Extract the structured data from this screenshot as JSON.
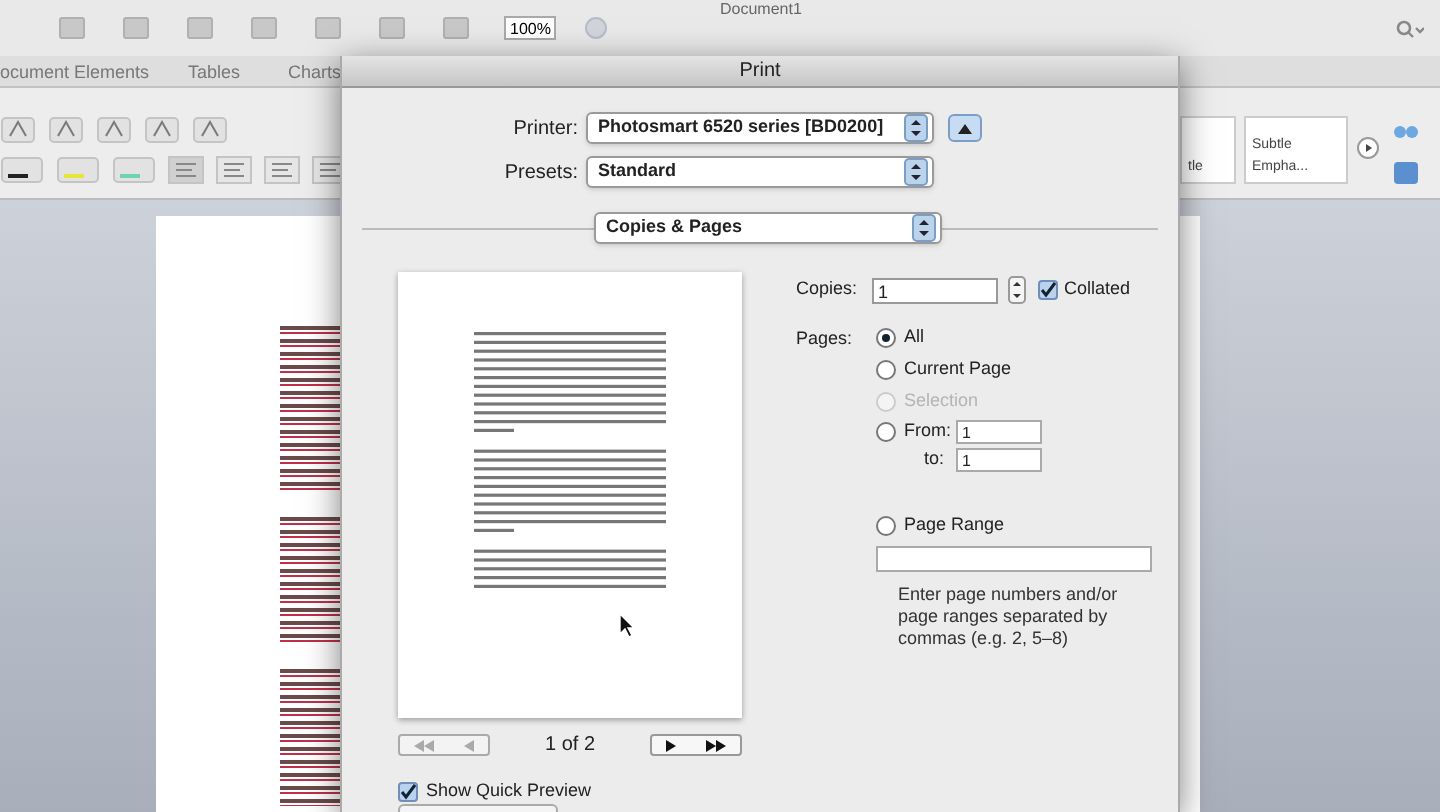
{
  "window": {
    "title": "Document1"
  },
  "toolbar": {
    "zoom": "100%"
  },
  "ribbon": {
    "tabs": [
      {
        "label": "ocument Elements"
      },
      {
        "label": "Tables"
      },
      {
        "label": "Charts"
      }
    ],
    "styles": [
      {
        "label": "tle"
      },
      {
        "label": "Subtle Empha..."
      }
    ]
  },
  "dialog": {
    "title": "Print",
    "printer": {
      "label": "Printer:",
      "value": "Photosmart 6520 series [BD0200]"
    },
    "presets": {
      "label": "Presets:",
      "value": "Standard"
    },
    "section": "Copies & Pages",
    "preview": {
      "page": "1 of 2",
      "quick_preview": {
        "label": "Show Quick Preview",
        "checked": true
      }
    },
    "copies": {
      "label": "Copies:",
      "value": "1",
      "collated": {
        "label": "Collated",
        "checked": true
      }
    },
    "pages": {
      "label": "Pages:",
      "options": [
        {
          "kind": "plain",
          "label": "All",
          "selected": true,
          "disabled": false
        },
        {
          "kind": "plain",
          "label": "Current Page",
          "selected": false,
          "disabled": false
        },
        {
          "kind": "plain",
          "label": "Selection",
          "selected": false,
          "disabled": true
        },
        {
          "kind": "from",
          "label": "From:",
          "selected": false,
          "disabled": false,
          "value": "1",
          "to_label": "to:",
          "to_value": "1"
        },
        {
          "kind": "range",
          "label": "Page Range",
          "selected": false,
          "disabled": false,
          "hint": "Enter page numbers and/or page ranges separated by commas (e.g. 2, 5–8)"
        }
      ]
    }
  }
}
